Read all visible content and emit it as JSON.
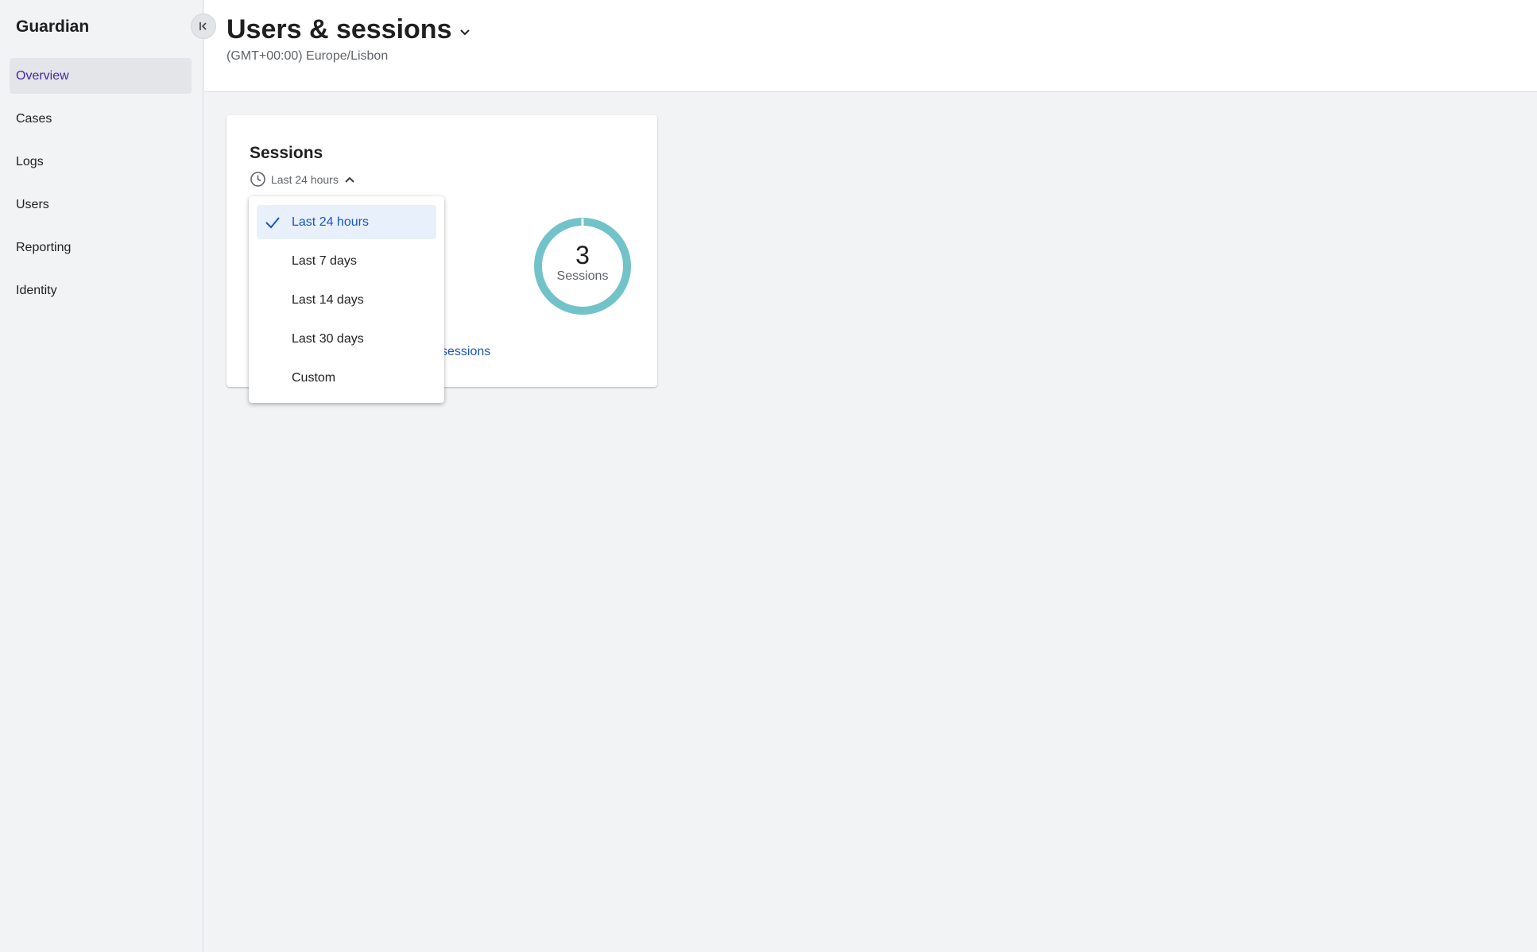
{
  "app": {
    "title": "Guardian"
  },
  "sidebar": {
    "items": [
      {
        "label": "Overview",
        "active": true
      },
      {
        "label": "Cases"
      },
      {
        "label": "Logs"
      },
      {
        "label": "Users"
      },
      {
        "label": "Reporting"
      },
      {
        "label": "Identity"
      }
    ]
  },
  "header": {
    "title": "Users & sessions",
    "timezone": "(GMT+00:00) Europe/Lisbon"
  },
  "card": {
    "title": "Sessions",
    "range_label": "Last 24 hours",
    "donut_value": "3",
    "donut_label": "Sessions",
    "link_text": "sessions",
    "ring_color": "#72c2c9"
  },
  "dropdown": {
    "options": [
      {
        "label": "Last 24 hours",
        "selected": true
      },
      {
        "label": "Last 7 days"
      },
      {
        "label": "Last 14 days"
      },
      {
        "label": "Last 30 days"
      },
      {
        "label": "Custom"
      }
    ]
  },
  "colors": {
    "accent": "#1a56c4",
    "active_nav": "#4527a0",
    "background": "#f2f3f5"
  }
}
